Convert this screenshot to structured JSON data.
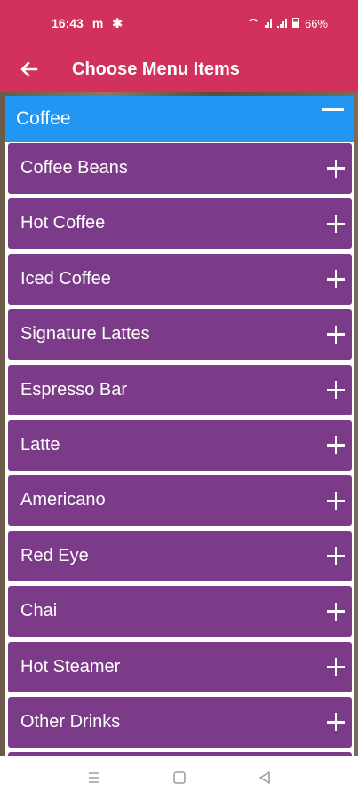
{
  "status_bar": {
    "time": "16:43",
    "left_glyphs": "m",
    "battery": "66%"
  },
  "app_bar": {
    "title": "Choose Menu Items"
  },
  "category": {
    "label": "Coffee",
    "items": [
      {
        "label": "Coffee Beans"
      },
      {
        "label": "Hot Coffee"
      },
      {
        "label": "Iced Coffee"
      },
      {
        "label": "Signature Lattes"
      },
      {
        "label": "Espresso Bar"
      },
      {
        "label": "Latte"
      },
      {
        "label": "Americano"
      },
      {
        "label": "Red Eye"
      },
      {
        "label": "Chai"
      },
      {
        "label": "Hot Steamer"
      },
      {
        "label": "Other Drinks"
      }
    ]
  },
  "colors": {
    "app_bar": "#d2315d",
    "category_header": "#2196f3",
    "menu_item": "#7b3b88"
  }
}
